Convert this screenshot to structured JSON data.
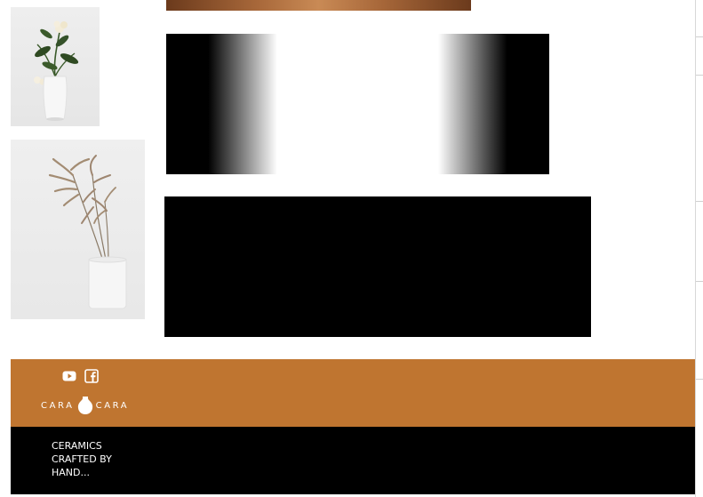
{
  "gallery": {
    "images": [
      {
        "icon": "white-vase-with-flowers-image"
      },
      {
        "icon": "white-vase-with-dried-reeds-image"
      }
    ]
  },
  "media": {
    "top_image_icon": "pottery-image",
    "gradient_panel_icon": "gradient-image",
    "video_icon": "video-player"
  },
  "footer": {
    "social": [
      {
        "icon": "youtube-icon"
      },
      {
        "icon": "facebook-icon"
      }
    ],
    "brand_left": "CARA",
    "brand_right": "CARA",
    "brand_logo_icon": "vase-logo-icon",
    "tagline": "CERAMICS CRAFTED BY HAND..."
  },
  "colors": {
    "accent": "#bf7530",
    "dark": "#000000",
    "text_light": "#ffffff"
  }
}
